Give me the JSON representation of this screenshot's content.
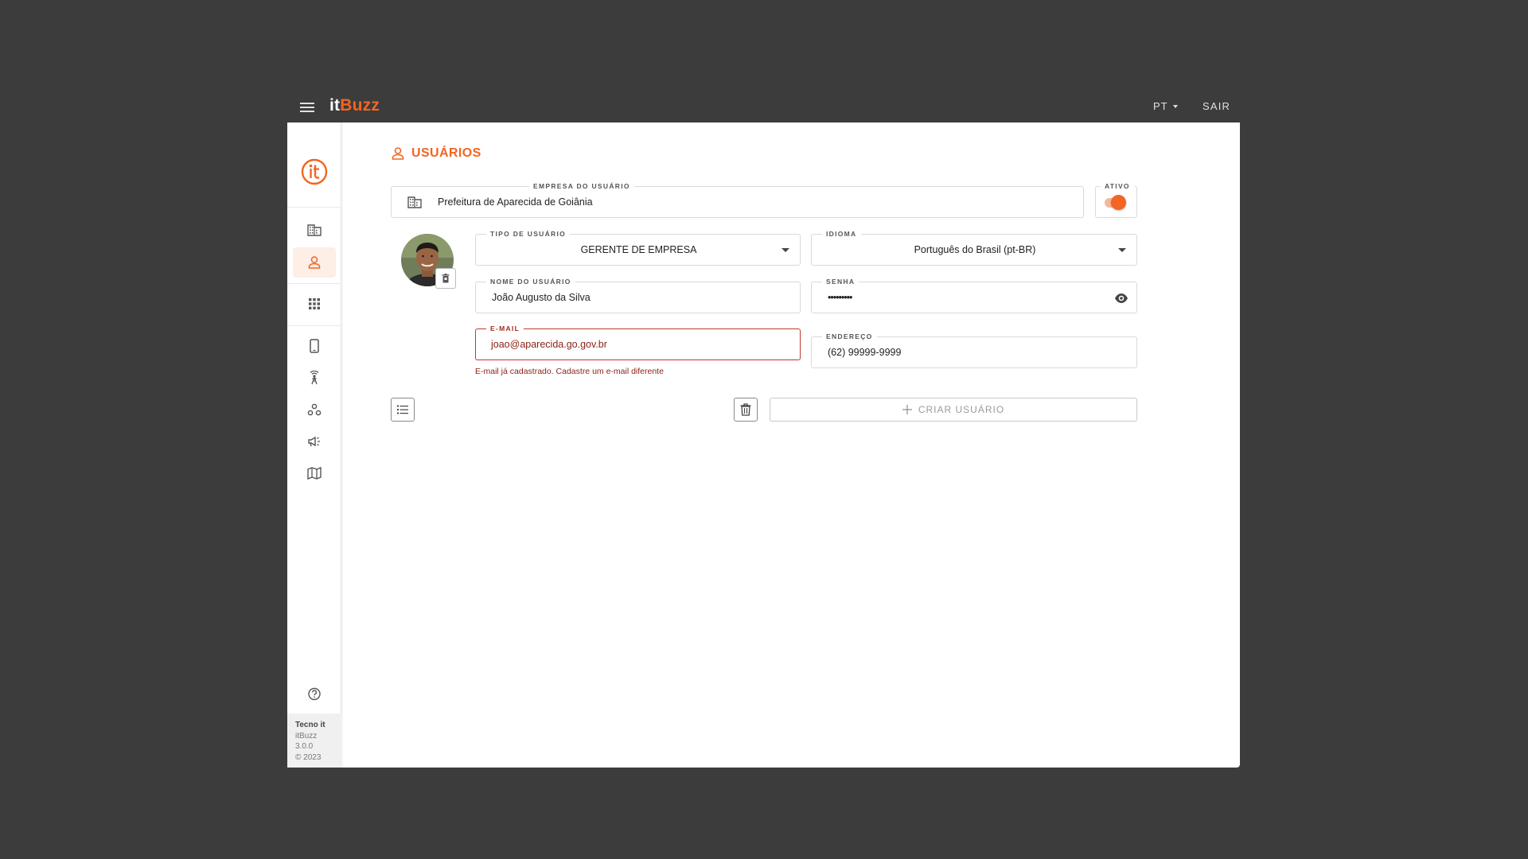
{
  "app": {
    "brand_prefix": "it",
    "brand_suffix": "Buzz",
    "language": "PT",
    "logout_label": "SAIR"
  },
  "colors": {
    "accent": "#f26522",
    "error": "#a32a1f",
    "background": "#3c3c3c"
  },
  "sidebar": {
    "items": [
      {
        "icon": "building-icon",
        "active": false
      },
      {
        "icon": "user-icon",
        "active": true
      },
      {
        "icon": "apps-grid-icon",
        "active": false
      },
      {
        "icon": "smartphone-icon",
        "active": false
      },
      {
        "icon": "broadcast-tower-icon",
        "active": false
      },
      {
        "icon": "groups-icon",
        "active": false
      },
      {
        "icon": "campaign-icon",
        "active": false
      },
      {
        "icon": "map-icon",
        "active": false
      },
      {
        "icon": "help-icon",
        "active": false
      }
    ],
    "footer": {
      "company": "Tecno it",
      "product": "itBuzz",
      "version": "3.0.0",
      "copyright": "© 2023"
    }
  },
  "page": {
    "title": "USUÁRIOS"
  },
  "form": {
    "company": {
      "label": "EMPRESA DO USUÁRIO",
      "value": "Prefeitura de Aparecida de Goiânia"
    },
    "active": {
      "label": "ATIVO",
      "value": true
    },
    "user_type": {
      "label": "TIPO DE USUÁRIO",
      "value": "GERENTE DE EMPRESA"
    },
    "language": {
      "label": "IDIOMA",
      "value": "Português do Brasil (pt-BR)"
    },
    "username": {
      "label": "NOME DO USUÁRIO",
      "value": "João Augusto da Silva"
    },
    "password": {
      "label": "SENHA",
      "value": "•••••••••"
    },
    "email": {
      "label": "E-MAIL",
      "value": "joao@aparecida.go.gov.br",
      "error": "E-mail já cadastrado. Cadastre um e-mail diferente"
    },
    "address": {
      "label": "ENDEREÇO",
      "value": "(62) 99999-9999"
    }
  },
  "actions": {
    "create_label": "CRIAR USUÁRIO"
  }
}
